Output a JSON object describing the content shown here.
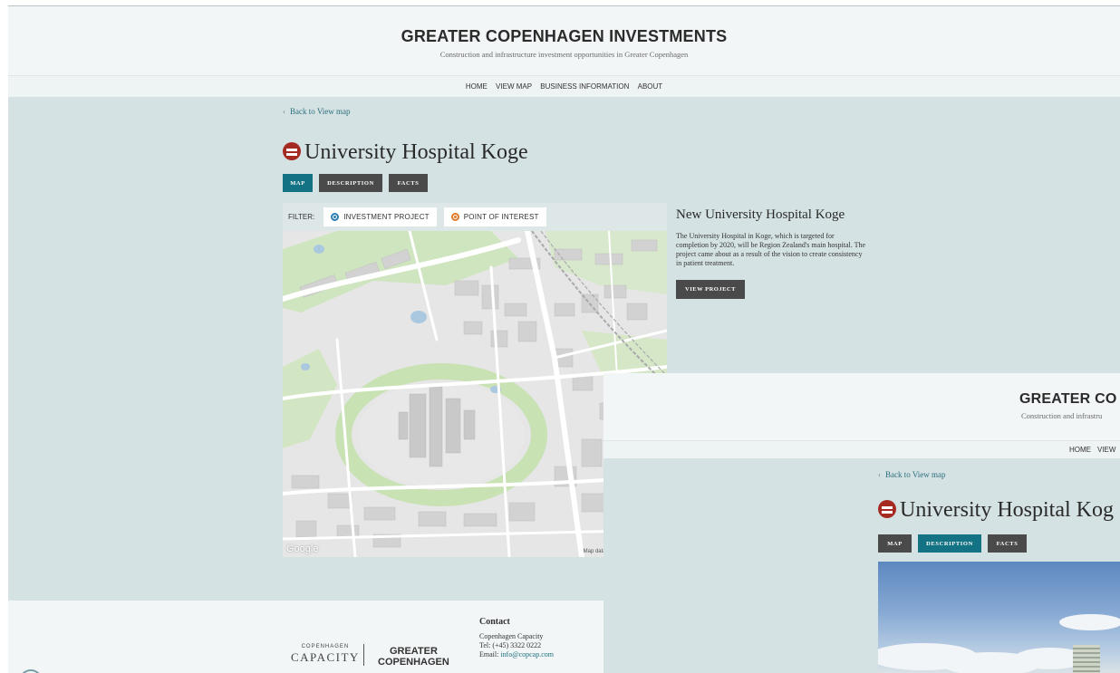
{
  "site": {
    "title": "GREATER COPENHAGEN INVESTMENTS",
    "subtitle": "Construction and infrastructure investment opportunities in Greater Copenhagen",
    "title_cut": "GREATER CO",
    "subtitle_cut": "Construction and infrastru"
  },
  "nav": {
    "items": [
      "HOME",
      "VIEW MAP",
      "BUSINESS INFORMATION",
      "ABOUT"
    ],
    "items_cut": [
      "HOME",
      "VIEW"
    ]
  },
  "page": {
    "back_link": "Back to View map",
    "title": "University Hospital Koge",
    "title_cut": "University Hospital Kog",
    "tabs": [
      "MAP",
      "DESCRIPTION",
      "FACTS"
    ]
  },
  "filter": {
    "label": "FILTER:",
    "chips": [
      "INVESTMENT PROJECT",
      "POINT OF INTEREST"
    ]
  },
  "map": {
    "credit": "Map data ©2015 Google   Terms o",
    "logo": "Google"
  },
  "info": {
    "heading": "New University Hospital Koge",
    "body": "The University Hospital in Koge, which is targeted for completion by 2020, will be Region Zealand's main hospital. The project came about as a result of the vision to create consistency in patient treatment.",
    "button": "VIEW PROJECT"
  },
  "footer": {
    "logo_cc_small": "COPENHAGEN",
    "logo_cc_big": "CAPACITY",
    "logo_gc_line1": "GREATER",
    "logo_gc_line2": "COPENHAGEN",
    "contact_heading": "Contact",
    "contact_org": "Copenhagen Capacity",
    "contact_tel": "Tel: (+45) 3322 0222",
    "contact_email_label": "Email:",
    "contact_email": "info@copcap.com"
  },
  "colors": {
    "accent": "#137283",
    "bg": "#d5e2e3",
    "pin": "#a52b22",
    "button_dark": "#4a4a4a"
  }
}
